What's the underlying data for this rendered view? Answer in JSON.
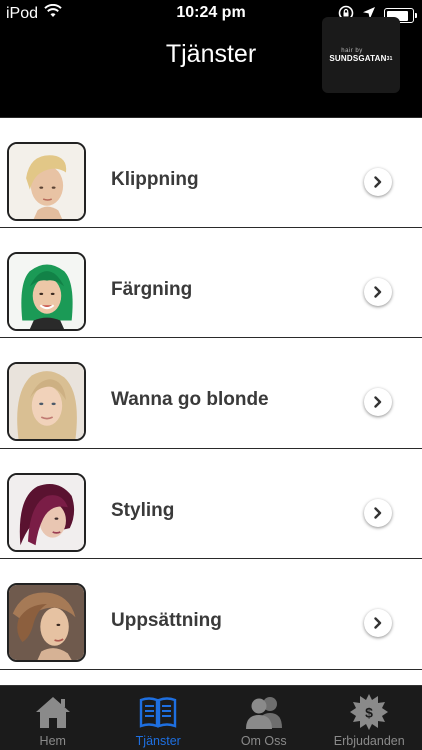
{
  "status_bar": {
    "carrier": "iPod",
    "time": "10:24 pm",
    "battery_level": 0.85
  },
  "header": {
    "title": "Tjänster",
    "logo": {
      "small_text": "hair by",
      "main_text": "SUNDSGATAN",
      "number": "31"
    }
  },
  "services": [
    {
      "label": "Klippning",
      "icon": "chevron-right-icon"
    },
    {
      "label": "Färgning",
      "icon": "chevron-right-icon"
    },
    {
      "label": "Wanna go blonde",
      "icon": "chevron-right-icon"
    },
    {
      "label": "Styling",
      "icon": "chevron-right-icon"
    },
    {
      "label": "Uppsättning",
      "icon": "chevron-right-icon"
    }
  ],
  "tabs": [
    {
      "label": "Hem",
      "icon": "home-icon",
      "active": false
    },
    {
      "label": "Tjänster",
      "icon": "book-icon",
      "active": true
    },
    {
      "label": "Om Oss",
      "icon": "people-icon",
      "active": false
    },
    {
      "label": "Erbjudanden",
      "icon": "price-badge-icon",
      "active": false
    }
  ],
  "colors": {
    "header_bg": "#000000",
    "tab_active": "#1e6fe0",
    "tab_inactive": "#8a8a8a"
  }
}
